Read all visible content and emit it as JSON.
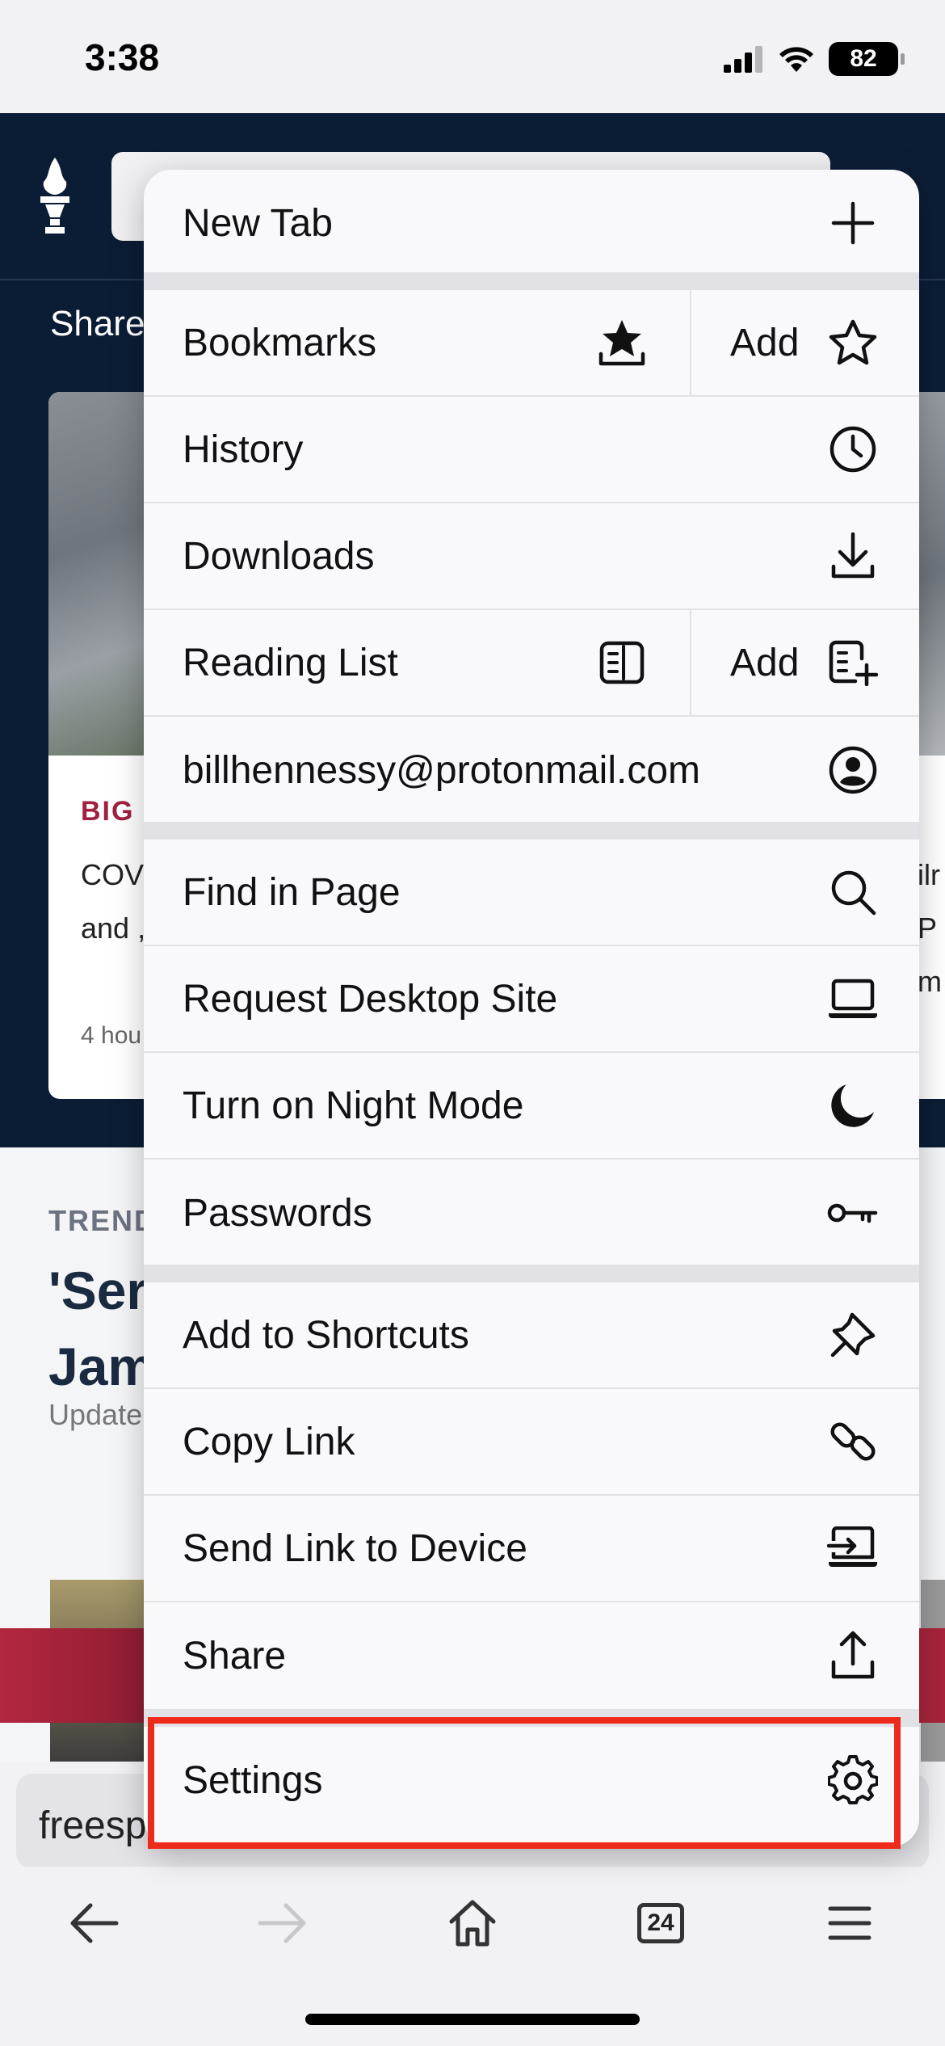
{
  "status": {
    "time": "3:38",
    "battery": "82"
  },
  "background": {
    "share_label": "Share",
    "card_left": {
      "kicker": "BIG E",
      "text_line1": "COVI",
      "text_line2": "and ,",
      "time": "4 hou"
    },
    "card_right": {
      "text_line1": "ilr",
      "text_line2": "P",
      "text_line3": "m"
    },
    "trending_label": "TREND",
    "headline_line1": "'Ser",
    "headline_line2": "Jam",
    "updated": "Update"
  },
  "url_bar": {
    "text": "freesp"
  },
  "toolbar": {
    "tabs_count": "24"
  },
  "menu": {
    "new_tab": "New Tab",
    "bookmarks": "Bookmarks",
    "bookmarks_add": "Add",
    "history": "History",
    "downloads": "Downloads",
    "reading_list": "Reading List",
    "reading_list_add": "Add",
    "account": "billhennessy@protonmail.com",
    "find_in_page": "Find in Page",
    "request_desktop_site": "Request Desktop Site",
    "night_mode": "Turn on Night Mode",
    "passwords": "Passwords",
    "add_to_shortcuts": "Add to Shortcuts",
    "copy_link": "Copy Link",
    "send_link": "Send Link to Device",
    "share": "Share",
    "settings": "Settings"
  },
  "colors": {
    "header_bg": "#0b1d35",
    "highlight": "#ee2a1b",
    "kicker": "#a0203f"
  }
}
